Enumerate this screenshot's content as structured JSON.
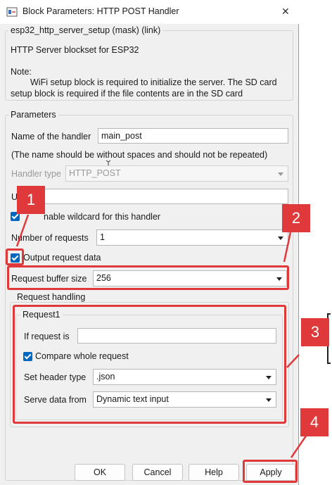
{
  "window": {
    "title": "Block Parameters: HTTP POST Handler",
    "close_symbol": "✕"
  },
  "mask": {
    "header": "esp32_http_server_setup (mask) (link)",
    "description": "HTTP Server blockset for ESP32",
    "note_label": "Note:",
    "note_line1": "WiFi setup block is required to initialize the server. The SD card",
    "note_line2": "setup block is required if the file contents are in the SD card"
  },
  "parameters": {
    "legend": "Parameters",
    "handler_name_label": "Name of the handler",
    "handler_name_value": "main_post",
    "handler_name_hint": "(The name should be without spaces and should not be repeated)",
    "handler_type_label": "Handler type",
    "handler_type_value": "HTTP_POST",
    "uri_label_partial": "U",
    "uri_value": "",
    "wildcard_label_partial": "nable wildcard for this handler",
    "num_requests_label": "Number of requests",
    "num_requests_value": "1",
    "output_request_label": "Output request data",
    "buffer_size_label": "Request buffer size",
    "buffer_size_value": "256"
  },
  "request_handling": {
    "legend": "Request handling",
    "request1": {
      "legend": "Request1",
      "if_request_label": "If request is",
      "if_request_value": "",
      "compare_label": "Compare whole request",
      "header_type_label": "Set header type",
      "header_type_value": ".json",
      "serve_from_label": "Serve data from",
      "serve_from_value": "Dynamic text input"
    }
  },
  "buttons": {
    "ok": "OK",
    "cancel": "Cancel",
    "help": "Help",
    "apply": "Apply"
  },
  "annotations": {
    "badge1": "1",
    "badge2": "2",
    "badge3": "3",
    "badge4": "4",
    "color": "#e0393b"
  },
  "colors": {
    "checkbox_accent": "#0067c0",
    "dialog_bg": "#f0f0f0"
  },
  "icons": {
    "app_icon": "simulink-block-icon",
    "close_icon": "close-icon",
    "cursor_icon": "text-cursor-icon"
  }
}
